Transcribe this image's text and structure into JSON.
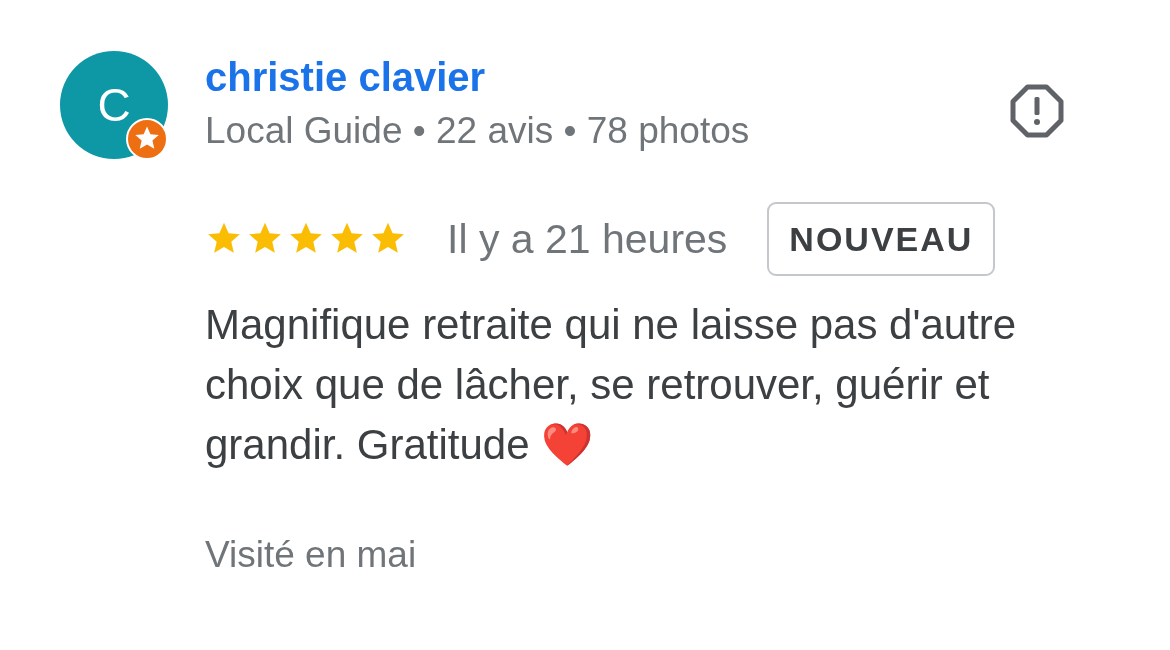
{
  "review": {
    "author": {
      "initial": "C",
      "name": "christie clavier",
      "meta": "Local Guide • 22 avis • 78 photos",
      "local_guide": true
    },
    "stars": 5,
    "time": "Il y a 21 heures",
    "tag": "NOUVEAU",
    "text": "Magnifique retraite qui ne laisse pas d'autre choix que de lâcher, se retrouver, guérir et grandir. Gratitude ❤️",
    "visited": "Visité en mai"
  }
}
